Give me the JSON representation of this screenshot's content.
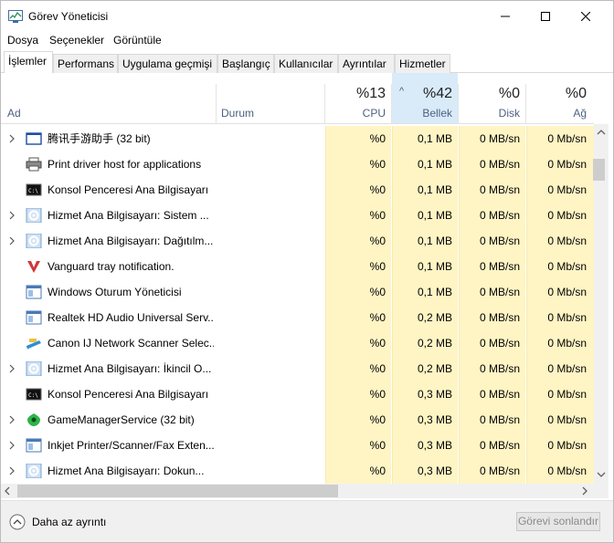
{
  "window": {
    "title": "Görev Yöneticisi"
  },
  "menu": [
    "Dosya",
    "Seçenekler",
    "Görüntüle"
  ],
  "tabs": [
    "İşlemler",
    "Performans",
    "Uygulama geçmişi",
    "Başlangıç",
    "Kullanıcılar",
    "Ayrıntılar",
    "Hizmetler"
  ],
  "columns": {
    "name": "Ad",
    "status": "Durum",
    "cpu": {
      "percent": "%13",
      "label": "CPU"
    },
    "memory": {
      "percent": "%42",
      "label": "Bellek"
    },
    "disk": {
      "percent": "%0",
      "label": "Disk"
    },
    "network": {
      "percent": "%0",
      "label": "Ağ"
    }
  },
  "processes": [
    {
      "name": "腾讯手游助手 (32 bit)",
      "icon": "window-icon",
      "expandable": true,
      "cpu": "%0",
      "memory": "0,1 MB",
      "disk": "0 MB/sn",
      "network": "0 Mb/sn"
    },
    {
      "name": "Print driver host for applications",
      "icon": "printer-icon",
      "expandable": false,
      "cpu": "%0",
      "memory": "0,1 MB",
      "disk": "0 MB/sn",
      "network": "0 Mb/sn"
    },
    {
      "name": "Konsol Penceresi Ana Bilgisayarı",
      "icon": "console-icon",
      "expandable": false,
      "cpu": "%0",
      "memory": "0,1 MB",
      "disk": "0 MB/sn",
      "network": "0 Mb/sn"
    },
    {
      "name": "Hizmet Ana Bilgisayarı: Sistem ...",
      "icon": "gear-icon",
      "expandable": true,
      "cpu": "%0",
      "memory": "0,1 MB",
      "disk": "0 MB/sn",
      "network": "0 Mb/sn"
    },
    {
      "name": "Hizmet Ana Bilgisayarı: Dağıtılm...",
      "icon": "gear-icon",
      "expandable": true,
      "cpu": "%0",
      "memory": "0,1 MB",
      "disk": "0 MB/sn",
      "network": "0 Mb/sn"
    },
    {
      "name": "Vanguard tray notification.",
      "icon": "vanguard-icon",
      "expandable": false,
      "cpu": "%0",
      "memory": "0,1 MB",
      "disk": "0 MB/sn",
      "network": "0 Mb/sn"
    },
    {
      "name": "Windows Oturum Yöneticisi",
      "icon": "app-window-icon",
      "expandable": false,
      "cpu": "%0",
      "memory": "0,1 MB",
      "disk": "0 MB/sn",
      "network": "0 Mb/sn"
    },
    {
      "name": "Realtek HD Audio Universal Serv...",
      "icon": "app-window-icon",
      "expandable": false,
      "cpu": "%0",
      "memory": "0,2 MB",
      "disk": "0 MB/sn",
      "network": "0 Mb/sn"
    },
    {
      "name": "Canon IJ Network Scanner Selec...",
      "icon": "scanner-icon",
      "expandable": false,
      "cpu": "%0",
      "memory": "0,2 MB",
      "disk": "0 MB/sn",
      "network": "0 Mb/sn"
    },
    {
      "name": "Hizmet Ana Bilgisayarı: İkincil O...",
      "icon": "gear-icon",
      "expandable": true,
      "cpu": "%0",
      "memory": "0,2 MB",
      "disk": "0 MB/sn",
      "network": "0 Mb/sn"
    },
    {
      "name": "Konsol Penceresi Ana Bilgisayarı",
      "icon": "console-icon",
      "expandable": false,
      "cpu": "%0",
      "memory": "0,3 MB",
      "disk": "0 MB/sn",
      "network": "0 Mb/sn"
    },
    {
      "name": "GameManagerService (32 bit)",
      "icon": "razer-icon",
      "expandable": true,
      "cpu": "%0",
      "memory": "0,3 MB",
      "disk": "0 MB/sn",
      "network": "0 Mb/sn"
    },
    {
      "name": "Inkjet Printer/Scanner/Fax Exten...",
      "icon": "app-window-icon",
      "expandable": true,
      "cpu": "%0",
      "memory": "0,3 MB",
      "disk": "0 MB/sn",
      "network": "0 Mb/sn"
    },
    {
      "name": "Hizmet Ana Bilgisayarı: Dokun...",
      "icon": "gear-icon",
      "expandable": true,
      "cpu": "%0",
      "memory": "0,3 MB",
      "disk": "0 MB/sn",
      "network": "0 Mb/sn"
    }
  ],
  "footer": {
    "less_details": "Daha az ayrıntı",
    "end_task": "Görevi sonlandır"
  },
  "colors": {
    "cell_highlight": "#fff4c4",
    "sorted_header": "#d9ebf9",
    "header_text": "#4d6082"
  }
}
